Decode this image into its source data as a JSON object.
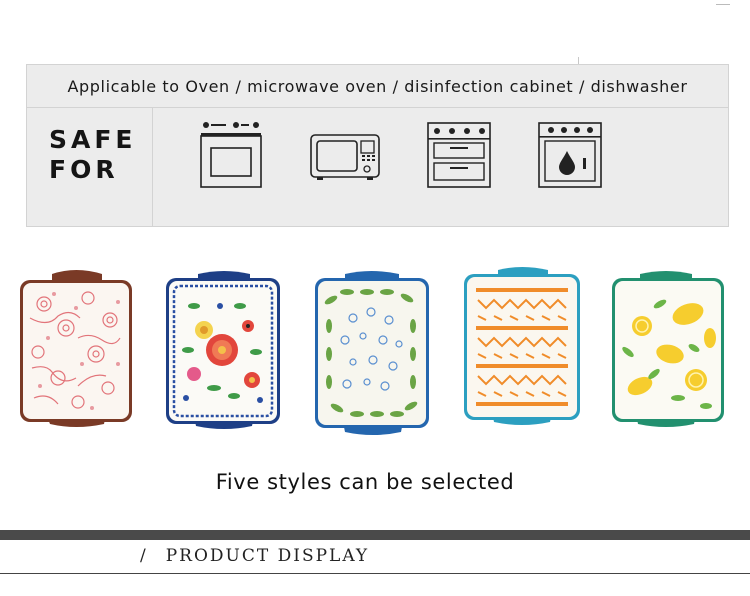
{
  "usage": {
    "applicable_text": "Applicable to Oven / microwave oven / disinfection cabinet / dishwasher",
    "safe_label_line1": "SAFE",
    "safe_label_line2": "FOR",
    "appliance_icons": [
      "oven-icon",
      "microwave-icon",
      "disinfection-cabinet-icon",
      "dishwasher-icon"
    ]
  },
  "products": {
    "styles": [
      {
        "pattern": "red-floral",
        "handle_color": "#7a3a26"
      },
      {
        "pattern": "blue-lace-flowers",
        "handle_color": "#1e3f86"
      },
      {
        "pattern": "green-leaf-wreath",
        "handle_color": "#2466ae"
      },
      {
        "pattern": "orange-geometric",
        "handle_color": "#2c9fc0"
      },
      {
        "pattern": "yellow-lemons",
        "handle_color": "#22906f"
      }
    ],
    "caption": "Five styles can be selected"
  },
  "section": {
    "slash": "/",
    "title": "PRODUCT DISPLAY"
  }
}
